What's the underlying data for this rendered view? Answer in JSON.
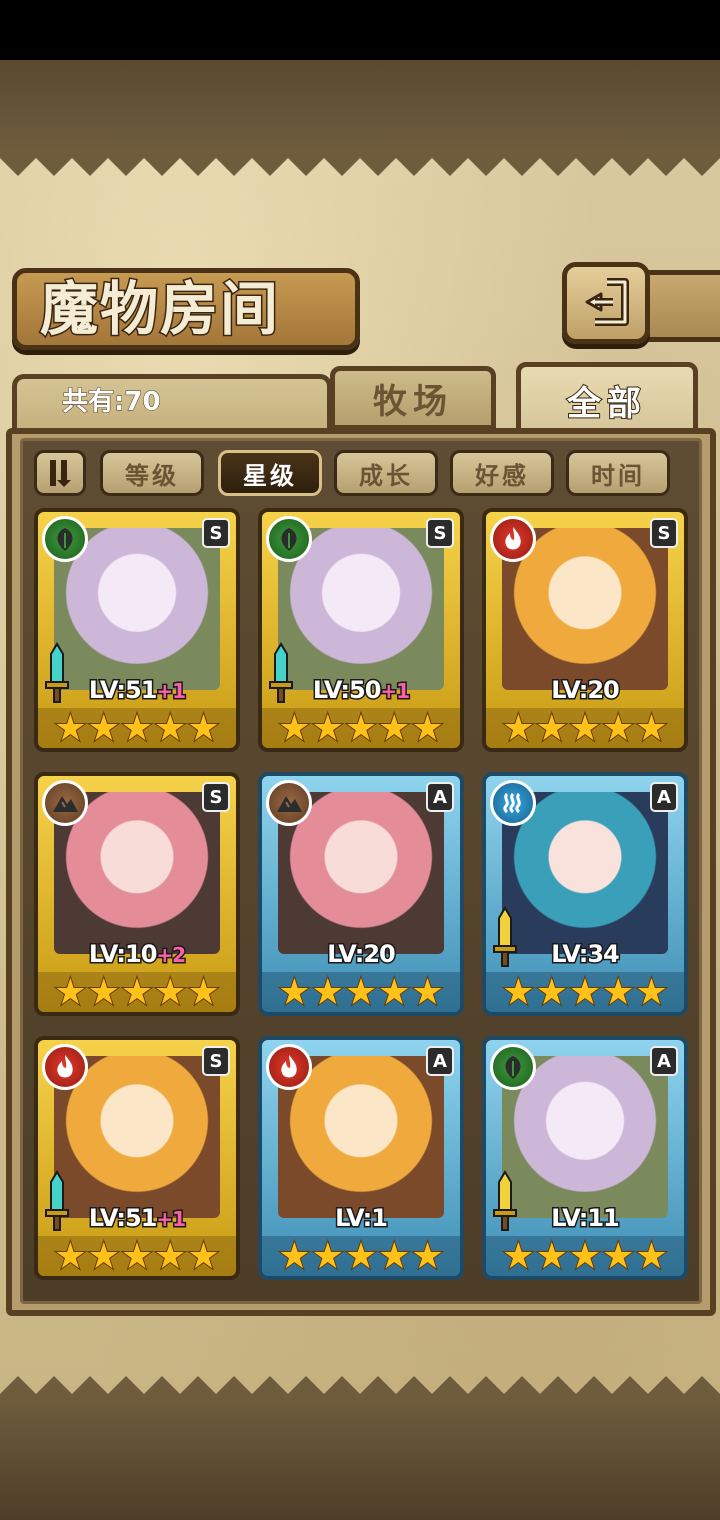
{
  "header": {
    "title": "魔物房间",
    "count_label": "共有:70"
  },
  "tabs": [
    {
      "label": "牧场",
      "active": false
    },
    {
      "label": "全部",
      "active": true
    }
  ],
  "sort": {
    "buttons": [
      {
        "label": "等级",
        "active": false
      },
      {
        "label": "星级",
        "active": true
      },
      {
        "label": "成长",
        "active": false
      },
      {
        "label": "好感",
        "active": false
      },
      {
        "label": "时间",
        "active": false
      }
    ]
  },
  "colors": {
    "gold_frame": "#f6d24a",
    "blue_frame": "#8fd4ee",
    "leaf": "#3b9b3b",
    "fire": "#e23a2a",
    "earth": "#9b6a44",
    "water": "#37a6e0"
  },
  "monsters": [
    {
      "rank": "S",
      "element": "leaf-icon",
      "level": "LV:51",
      "bonus": "+1",
      "stars": 5,
      "has_weapon": true
    },
    {
      "rank": "S",
      "element": "leaf-icon",
      "level": "LV:50",
      "bonus": "+1",
      "stars": 5,
      "has_weapon": true
    },
    {
      "rank": "S",
      "element": "fire-icon",
      "level": "LV:20",
      "bonus": "",
      "stars": 5,
      "has_weapon": false
    },
    {
      "rank": "S",
      "element": "earth-icon",
      "level": "LV:10",
      "bonus": "+2",
      "stars": 5,
      "has_weapon": false
    },
    {
      "rank": "A",
      "element": "earth-icon",
      "level": "LV:20",
      "bonus": "",
      "stars": 5,
      "has_weapon": false
    },
    {
      "rank": "A",
      "element": "water-icon",
      "level": "LV:34",
      "bonus": "",
      "stars": 5,
      "has_weapon": true
    },
    {
      "rank": "S",
      "element": "fire-icon",
      "level": "LV:51",
      "bonus": "+1",
      "stars": 5,
      "has_weapon": true
    },
    {
      "rank": "A",
      "element": "fire-icon",
      "level": "LV:1",
      "bonus": "",
      "stars": 5,
      "has_weapon": false
    },
    {
      "rank": "A",
      "element": "leaf-icon",
      "level": "LV:11",
      "bonus": "",
      "stars": 5,
      "has_weapon": true
    }
  ]
}
